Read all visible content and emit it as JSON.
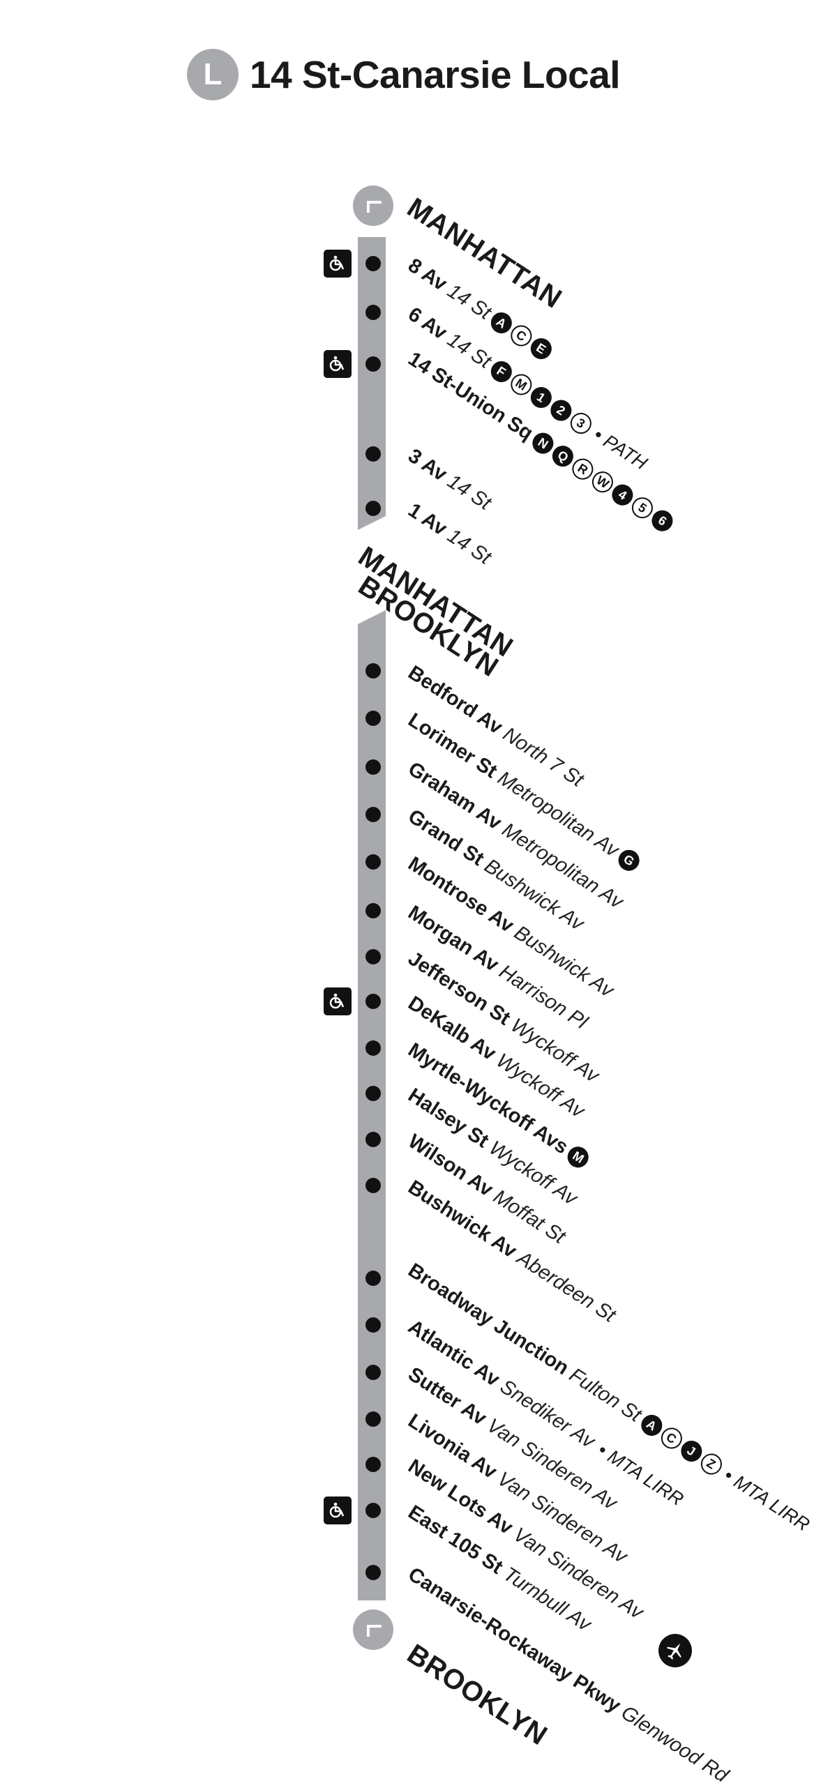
{
  "title": {
    "route_letter": "L",
    "text": "14 St-Canarsie Local"
  },
  "sections": {
    "manhattan_top": "MANHATTAN",
    "manhattan_mid": "MANHATTAN",
    "brooklyn_mid": "BROOKLYN",
    "brooklyn_bottom": "BROOKLYN"
  },
  "stations": [
    {
      "name": "8 Av",
      "street": "14 St",
      "transfers": [
        "A",
        "C",
        "E"
      ],
      "extras": [],
      "accessible": true
    },
    {
      "name": "6 Av",
      "street": "14 St",
      "transfers": [
        "F",
        "M",
        "1",
        "2",
        "3"
      ],
      "extras": [
        "PATH"
      ],
      "accessible": false
    },
    {
      "name": "14 St-Union Sq",
      "street": "",
      "transfers": [
        "N",
        "Q",
        "R",
        "W",
        "4",
        "5",
        "6"
      ],
      "extras": [],
      "accessible": true
    },
    {
      "name": "3 Av",
      "street": "14 St",
      "transfers": [],
      "extras": [],
      "accessible": false
    },
    {
      "name": "1 Av",
      "street": "14 St",
      "transfers": [],
      "extras": [],
      "accessible": false
    },
    {
      "name": "Bedford Av",
      "street": "North 7 St",
      "transfers": [],
      "extras": [],
      "accessible": false
    },
    {
      "name": "Lorimer St",
      "street": "Metropolitan Av",
      "transfers": [
        "G"
      ],
      "extras": [],
      "accessible": false
    },
    {
      "name": "Graham Av",
      "street": "Metropolitan Av",
      "transfers": [],
      "extras": [],
      "accessible": false
    },
    {
      "name": "Grand St",
      "street": "Bushwick Av",
      "transfers": [],
      "extras": [],
      "accessible": false
    },
    {
      "name": "Montrose Av",
      "street": "Bushwick Av",
      "transfers": [],
      "extras": [],
      "accessible": false
    },
    {
      "name": "Morgan Av",
      "street": "Harrison Pl",
      "transfers": [],
      "extras": [],
      "accessible": false
    },
    {
      "name": "Jefferson St",
      "street": "Wyckoff Av",
      "transfers": [],
      "extras": [],
      "accessible": false
    },
    {
      "name": "DeKalb Av",
      "street": "Wyckoff Av",
      "transfers": [],
      "extras": [],
      "accessible": true
    },
    {
      "name": "Myrtle-Wyckoff Avs",
      "street": "",
      "transfers": [
        "M"
      ],
      "extras": [],
      "accessible": false
    },
    {
      "name": "Halsey St",
      "street": "Wyckoff Av",
      "transfers": [],
      "extras": [],
      "accessible": false
    },
    {
      "name": "Wilson Av",
      "street": "Moffat St",
      "transfers": [],
      "extras": [],
      "accessible": false
    },
    {
      "name": "Bushwick Av",
      "street": "Aberdeen St",
      "transfers": [],
      "extras": [],
      "accessible": false
    },
    {
      "name": "Broadway Junction",
      "street": "Fulton St",
      "transfers": [
        "A",
        "C",
        "J",
        "Z"
      ],
      "extras": [
        "MTA LIRR"
      ],
      "accessible": false
    },
    {
      "name": "Atlantic Av",
      "street": "Snediker Av",
      "transfers": [],
      "extras": [
        "MTA LIRR"
      ],
      "accessible": false
    },
    {
      "name": "Sutter Av",
      "street": "Van Sinderen Av",
      "transfers": [],
      "extras": [],
      "accessible": false
    },
    {
      "name": "Livonia Av",
      "street": "Van Sinderen Av",
      "transfers": [],
      "extras": [],
      "accessible": false
    },
    {
      "name": "New Lots Av",
      "street": "Van Sinderen Av",
      "transfers": [],
      "extras": [],
      "accessible": false
    },
    {
      "name": "East 105 St",
      "street": "Turnbull Av",
      "transfers": [],
      "extras": [],
      "accessible": true
    },
    {
      "name": "Canarsie-Rockaway Pkwy",
      "street": "Glenwood Rd",
      "transfers": [],
      "extras": [],
      "accessible": false,
      "airport": true
    }
  ],
  "colors": {
    "line": "#a7a9ac",
    "station_dot": "#111111",
    "bullet_filled": "#111111",
    "bullet_outline": "#111111"
  },
  "icons": {
    "accessible": "wheelchair-icon",
    "airport": "airplane-icon",
    "terminal": "terminal-arrow-icon"
  }
}
